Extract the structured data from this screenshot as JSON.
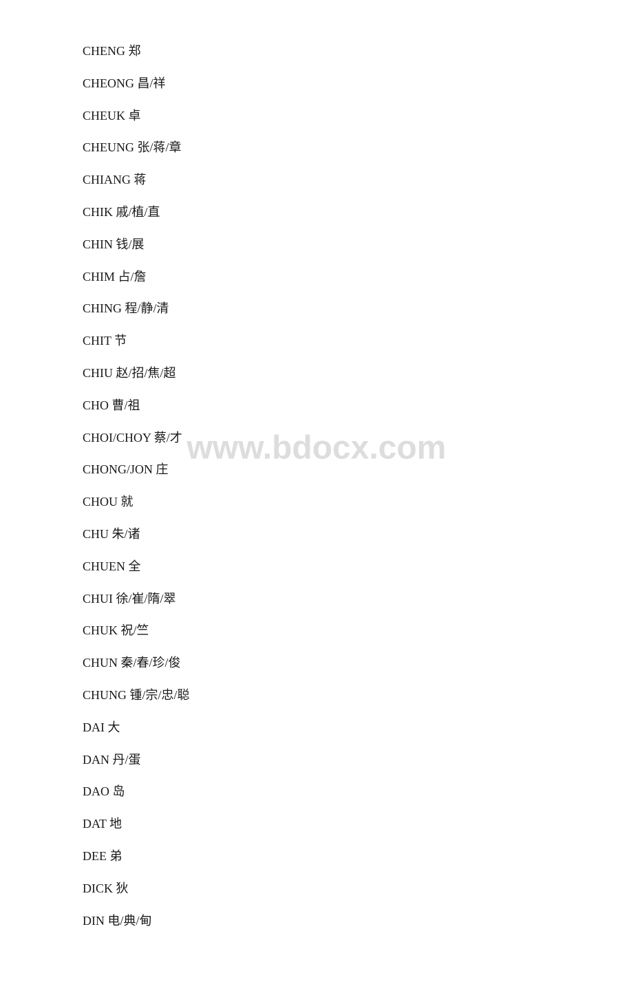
{
  "watermark": "www.bdocx.com",
  "entries": [
    {
      "id": "cheng",
      "text": "CHENG 郑"
    },
    {
      "id": "cheong",
      "text": "CHEONG 昌/祥"
    },
    {
      "id": "cheuk",
      "text": "CHEUK 卓"
    },
    {
      "id": "cheung",
      "text": "CHEUNG 张/蒋/章"
    },
    {
      "id": "chiang",
      "text": "CHIANG 蒋"
    },
    {
      "id": "chik",
      "text": "CHIK 戚/植/直"
    },
    {
      "id": "chin",
      "text": "CHIN 钱/展"
    },
    {
      "id": "chim",
      "text": "CHIM 占/詹"
    },
    {
      "id": "ching",
      "text": "CHING 程/静/清"
    },
    {
      "id": "chit",
      "text": "CHIT 节"
    },
    {
      "id": "chiu",
      "text": "CHIU 赵/招/焦/超"
    },
    {
      "id": "cho",
      "text": "CHO 曹/祖"
    },
    {
      "id": "choi-choy",
      "text": "CHOI/CHOY 蔡/才"
    },
    {
      "id": "chong-jon",
      "text": "CHONG/JON 庄"
    },
    {
      "id": "chou",
      "text": "CHOU 就"
    },
    {
      "id": "chu",
      "text": "CHU 朱/诸"
    },
    {
      "id": "chuen",
      "text": "CHUEN 全"
    },
    {
      "id": "chui",
      "text": "CHUI 徐/崔/隋/翠"
    },
    {
      "id": "chuk",
      "text": "CHUK 祝/竺"
    },
    {
      "id": "chun",
      "text": "CHUN 秦/春/珍/俊"
    },
    {
      "id": "chung",
      "text": "CHUNG 锺/宗/忠/聪"
    },
    {
      "id": "dai",
      "text": "DAI 大"
    },
    {
      "id": "dan",
      "text": "DAN 丹/蛋"
    },
    {
      "id": "dao",
      "text": "DAO 岛"
    },
    {
      "id": "dat",
      "text": "DAT 地"
    },
    {
      "id": "dee",
      "text": "DEE 弟"
    },
    {
      "id": "dick",
      "text": "DICK 狄"
    },
    {
      "id": "din",
      "text": "DIN 电/典/甸"
    }
  ]
}
